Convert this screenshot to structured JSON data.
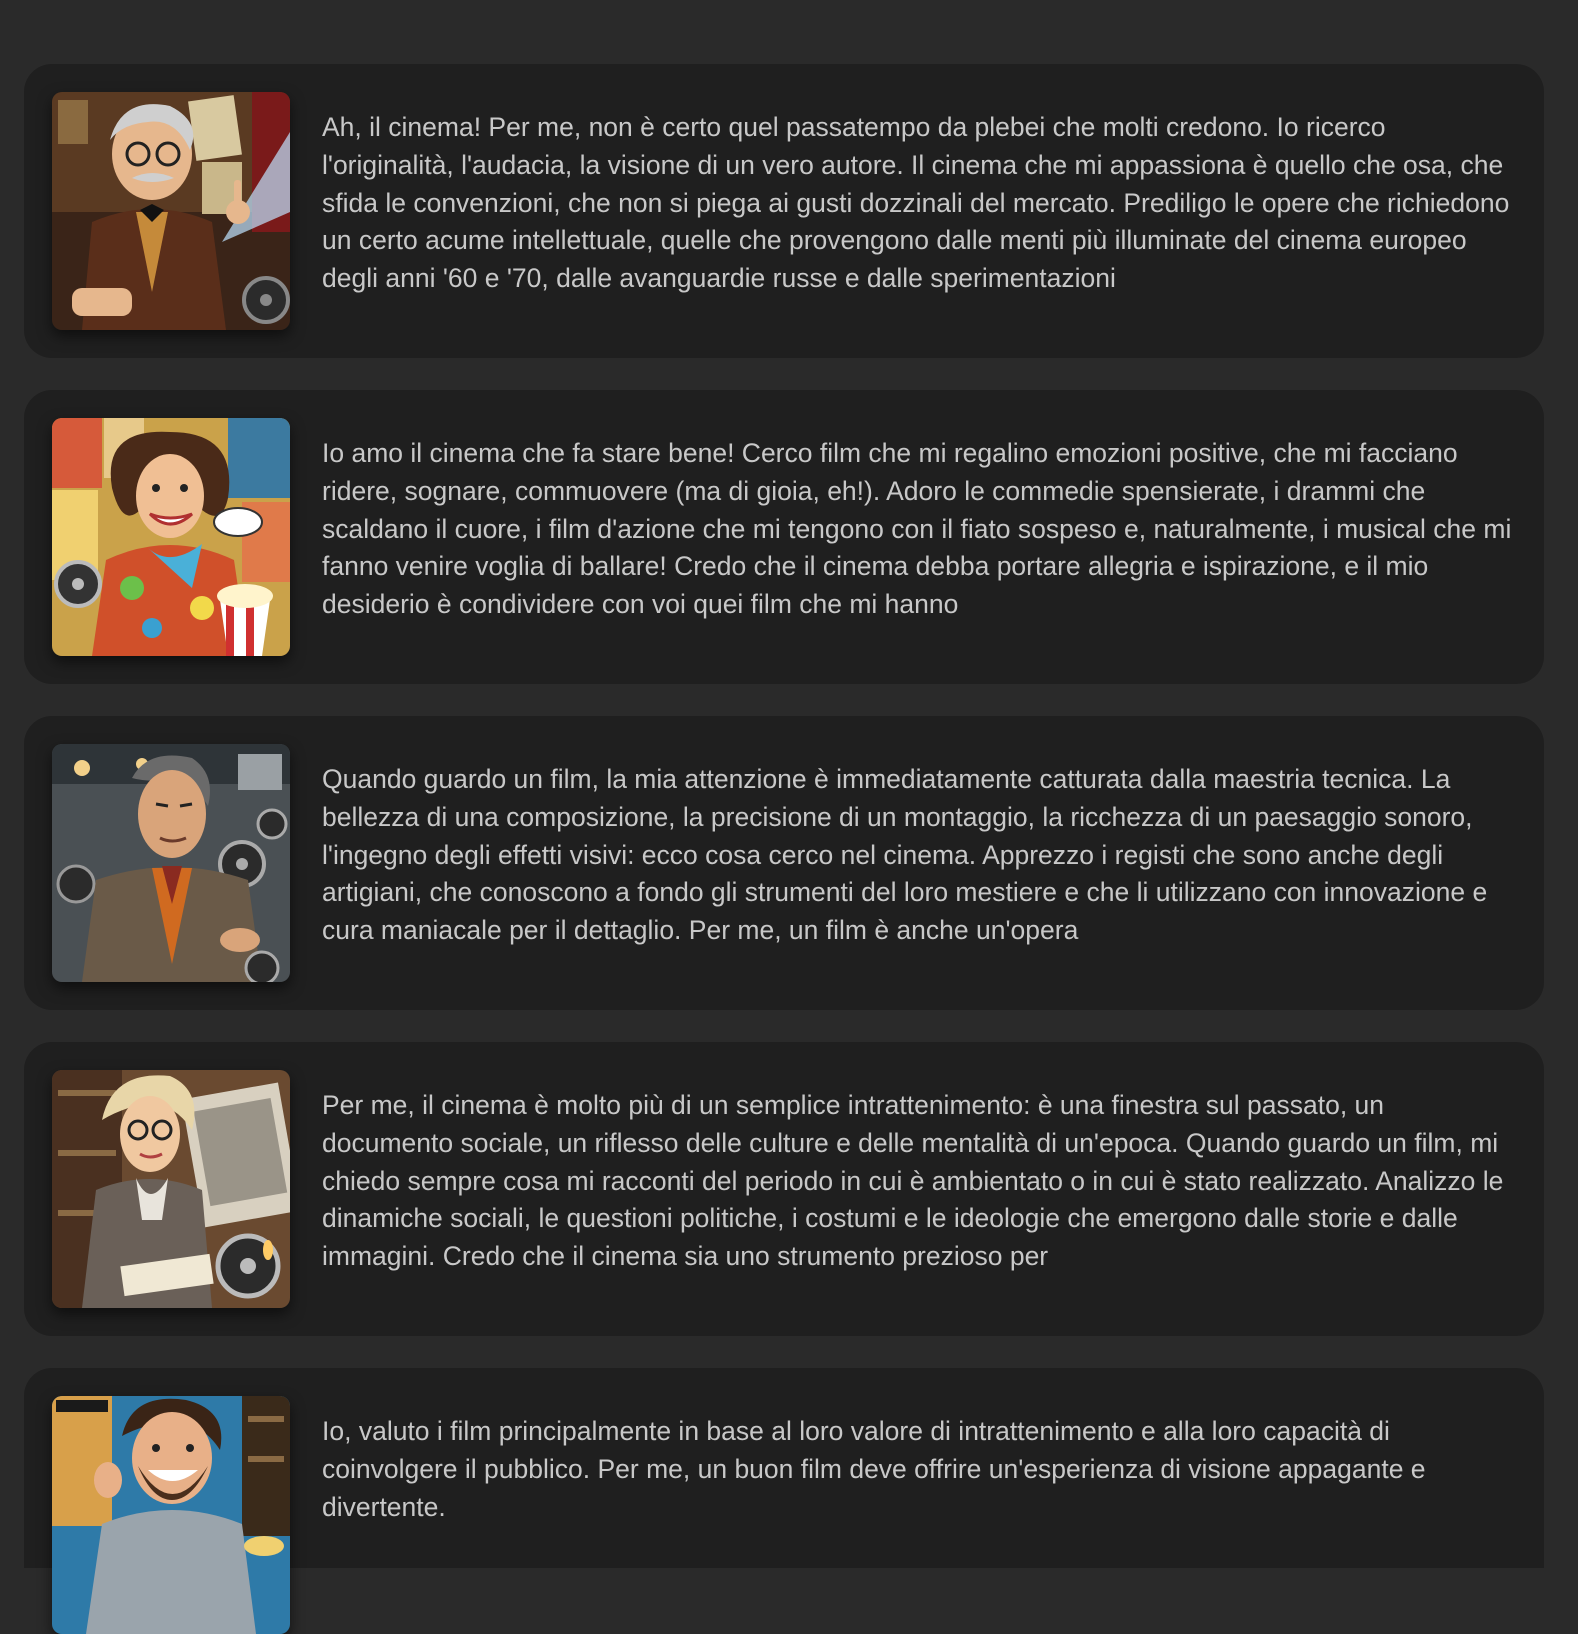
{
  "profiles": [
    {
      "avatar_icon": "cinephile-intellectual-portrait",
      "description": "Ah, il cinema! Per me, non è certo quel passatempo da plebei che molti credono. Io ricerco l'originalità, l'audacia, la visione di un vero autore. Il cinema che mi appassiona è quello che osa, che sfida le convenzioni, che non si piega ai gusti dozzinali del mercato. Prediligo le opere che richiedono un certo acume intellettuale, quelle che provengono dalle menti più illuminate del cinema europeo degli anni '60 e '70, dalle avanguardie russe e dalle sperimentazioni"
    },
    {
      "avatar_icon": "cheerful-moviegoer-portrait",
      "description": "Io amo il cinema che fa stare bene! Cerco film che mi regalino emozioni positive, che mi facciano ridere, sognare, commuovere (ma di gioia, eh!). Adoro le commedie spensierate, i drammi che scaldano il cuore, i film d'azione che mi tengono con il fiato sospeso e, naturalmente, i musical che mi fanno venire voglia di ballare! Credo che il cinema debba portare allegria e ispirazione, e il mio desiderio è condividere con voi quei film che mi hanno"
    },
    {
      "avatar_icon": "technical-craftsman-portrait",
      "description": "Quando guardo un film, la mia attenzione è immediatamente catturata dalla maestria tecnica. La bellezza di una composizione, la precisione di un montaggio, la ricchezza di un paesaggio sonoro, l'ingegno degli effetti visivi: ecco cosa cerco nel cinema. Apprezzo i registi che sono anche degli artigiani, che conoscono a fondo gli strumenti del loro mestiere e che li utilizzano con innovazione e cura maniacale per il dettaglio. Per me, un film è anche un'opera"
    },
    {
      "avatar_icon": "film-historian-portrait",
      "description": "Per me, il cinema è molto più di un semplice intrattenimento: è una finestra sul passato, un documento sociale, un riflesso delle culture e delle mentalità di un'epoca. Quando guardo un film, mi chiedo sempre cosa mi racconti del periodo in cui è ambientato o in cui è stato realizzato. Analizzo le dinamiche sociali, le questioni politiche, i costumi e le ideologie che emergono dalle storie e dalle immagini. Credo che il cinema sia uno strumento prezioso per"
    },
    {
      "avatar_icon": "entertainment-fan-portrait",
      "description": "Io, valuto i film principalmente in base al loro valore di intrattenimento e alla loro capacità di coinvolgere il pubblico. Per me, un buon film deve offrire un'esperienza di visione appagante e divertente."
    }
  ]
}
